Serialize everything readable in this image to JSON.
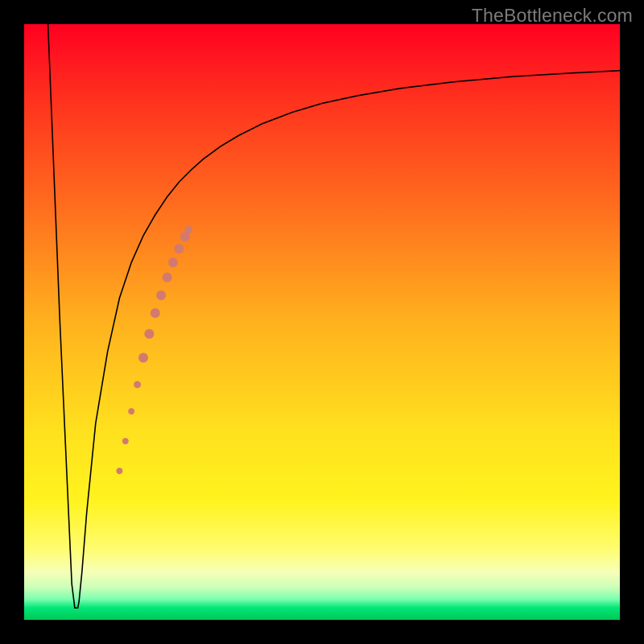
{
  "watermark": "TheBottleneck.com",
  "chart_data": {
    "type": "line",
    "title": "",
    "xlabel": "",
    "ylabel": "",
    "xlim": [
      0,
      100
    ],
    "ylim": [
      0,
      100
    ],
    "grid": false,
    "legend": false,
    "background_gradient": {
      "direction": "vertical",
      "stops": [
        {
          "pos": 0.0,
          "color": "#ff0021"
        },
        {
          "pos": 0.3,
          "color": "#ff6b1e"
        },
        {
          "pos": 0.68,
          "color": "#ffe01e"
        },
        {
          "pos": 0.92,
          "color": "#f6ffb8"
        },
        {
          "pos": 1.0,
          "color": "#00c853"
        }
      ]
    },
    "series": [
      {
        "name": "bottleneck-curve",
        "color": "#000000",
        "stroke_width": 1.6,
        "x": [
          4,
          6,
          8,
          8.5,
          9,
          9.2,
          9.7,
          10.5,
          12,
          14,
          16,
          18,
          20,
          22,
          24,
          26,
          28,
          30,
          33,
          36,
          40,
          45,
          50,
          56,
          63,
          72,
          82,
          92,
          100
        ],
        "y": [
          100,
          50,
          6,
          2,
          2,
          3,
          8,
          18,
          33,
          45,
          54,
          60,
          64.5,
          68,
          71,
          73.5,
          75.5,
          77.3,
          79.5,
          81.3,
          83.3,
          85.2,
          86.7,
          88.0,
          89.2,
          90.3,
          91.2,
          91.8,
          92.2
        ]
      }
    ],
    "overlay_markers": {
      "name": "highlight-dots",
      "color": "#d37a6f",
      "points": [
        {
          "x": 16.0,
          "y": 25.0,
          "r": 4
        },
        {
          "x": 17.0,
          "y": 30.0,
          "r": 4
        },
        {
          "x": 18.0,
          "y": 35.0,
          "r": 4
        },
        {
          "x": 19.0,
          "y": 39.5,
          "r": 4.5
        },
        {
          "x": 20.0,
          "y": 44.0,
          "r": 6
        },
        {
          "x": 21.0,
          "y": 48.0,
          "r": 6
        },
        {
          "x": 22.0,
          "y": 51.5,
          "r": 6
        },
        {
          "x": 23.0,
          "y": 54.5,
          "r": 6
        },
        {
          "x": 24.0,
          "y": 57.5,
          "r": 6
        },
        {
          "x": 25.0,
          "y": 60.0,
          "r": 6
        },
        {
          "x": 26.0,
          "y": 62.3,
          "r": 6
        },
        {
          "x": 27.0,
          "y": 64.3,
          "r": 6
        },
        {
          "x": 27.6,
          "y": 65.5,
          "r": 5
        }
      ]
    }
  }
}
